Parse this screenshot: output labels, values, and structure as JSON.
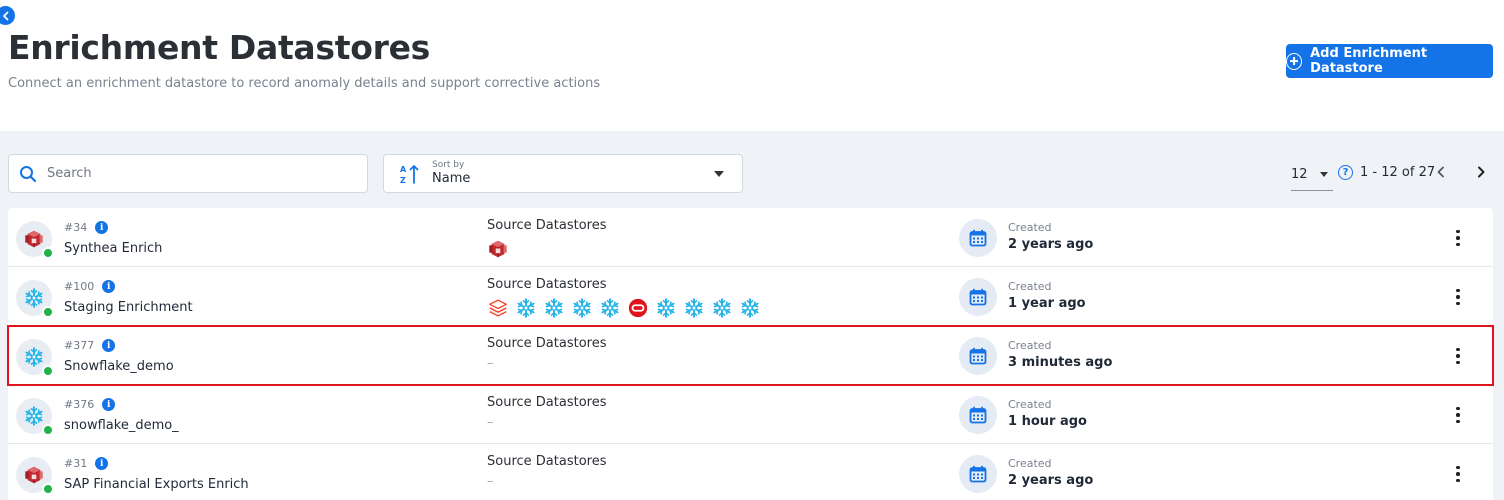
{
  "header": {
    "title": "Enrichment Datastores",
    "subtitle": "Connect an enrichment datastore to record anomaly details and support corrective actions",
    "add_button_label": "Add Enrichment Datastore"
  },
  "toolbar": {
    "search_placeholder": "Search",
    "sort_by_label": "Sort by",
    "sort_value": "Name",
    "per_page": "12",
    "range_text": "1 - 12 of 27"
  },
  "colors": {
    "accent": "#1473e6",
    "status_green": "#21b24b",
    "highlight_red": "#e0151b",
    "snowflake": "#29b5e8",
    "redshift": "#c1272d",
    "oracle": "#e0151b",
    "databricks": "#ff3621"
  },
  "rows": [
    {
      "id": "#34",
      "name": "Synthea Enrich",
      "icon": "redshift-icon",
      "status": "connected",
      "sources_label": "Source Datastores",
      "sources": [
        "redshift-icon"
      ],
      "created_label": "Created",
      "created_value": "2 years ago",
      "highlighted": false
    },
    {
      "id": "#100",
      "name": "Staging Enrichment",
      "icon": "snowflake-icon",
      "status": "connected",
      "sources_label": "Source Datastores",
      "sources": [
        "databricks-icon",
        "snowflake-icon",
        "snowflake-icon",
        "snowflake-icon",
        "snowflake-icon",
        "oracle-icon",
        "snowflake-icon",
        "snowflake-icon",
        "snowflake-icon",
        "snowflake-icon"
      ],
      "created_label": "Created",
      "created_value": "1 year ago",
      "highlighted": false
    },
    {
      "id": "#377",
      "name": "Snowflake_demo",
      "icon": "snowflake-icon",
      "status": "connected",
      "sources_label": "Source Datastores",
      "sources": [],
      "sources_empty": "–",
      "created_label": "Created",
      "created_value": "3 minutes ago",
      "highlighted": true
    },
    {
      "id": "#376",
      "name": "snowflake_demo_",
      "icon": "snowflake-icon",
      "status": "connected",
      "sources_label": "Source Datastores",
      "sources": [],
      "sources_empty": "–",
      "created_label": "Created",
      "created_value": "1 hour ago",
      "highlighted": false
    },
    {
      "id": "#31",
      "name": "SAP Financial Exports Enrich",
      "icon": "redshift-icon",
      "status": "connected",
      "sources_label": "Source Datastores",
      "sources": [],
      "sources_empty": "–",
      "created_label": "Created",
      "created_value": "2 years ago",
      "highlighted": false
    }
  ]
}
